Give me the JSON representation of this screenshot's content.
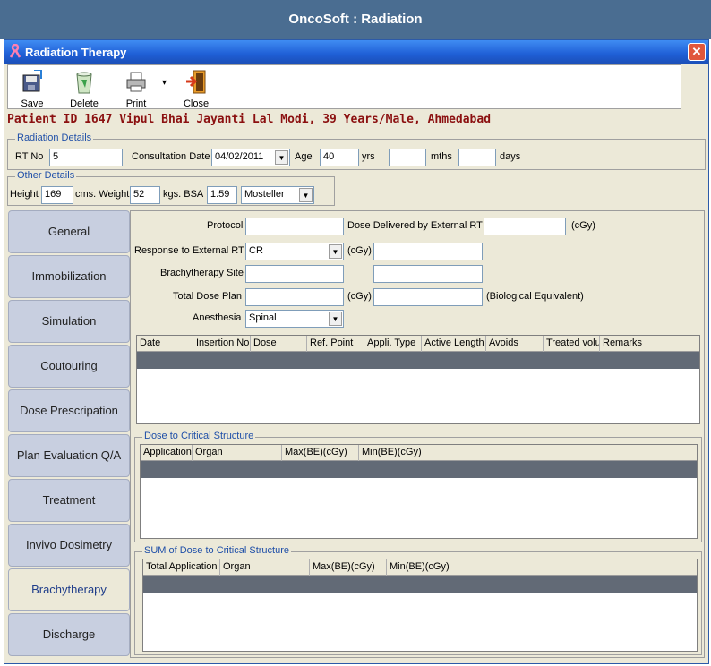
{
  "app": {
    "banner_title": "OncoSoft : Radiation"
  },
  "window": {
    "title": "Radiation Therapy",
    "close_glyph": "✕"
  },
  "toolbar": {
    "save": "Save",
    "delete": "Delete",
    "print": "Print",
    "print_menu_glyph": "▾",
    "close": "Close"
  },
  "patient": {
    "banner": "Patient ID 1647 Vipul Bhai Jayanti Lal  Modi, 39 Years/Male, Ahmedabad"
  },
  "radiation_details": {
    "legend": "Radiation Details",
    "rt_no_label": "RT No",
    "rt_no_value": "5",
    "consult_label": "Consultation Date",
    "consult_value": "04/02/2011",
    "age_label": "Age",
    "age_years_value": "40",
    "yrs": "yrs",
    "age_months_value": "",
    "mths": "mths",
    "age_days_value": "",
    "days": "days"
  },
  "other_details": {
    "legend": "Other Details",
    "height_label": "Height",
    "height_value": "169",
    "cms_weight": "cms. Weight",
    "weight_value": "52",
    "kgs_bsa": "kgs. BSA",
    "bsa_value": "1.59",
    "method_value": "Mosteller"
  },
  "tabs": [
    {
      "label": "General"
    },
    {
      "label": "Immobilization"
    },
    {
      "label": "Simulation"
    },
    {
      "label": "Coutouring"
    },
    {
      "label": "Dose Prescripation"
    },
    {
      "label": "Plan Evaluation Q/A"
    },
    {
      "label": "Treatment"
    },
    {
      "label": "Invivo Dosimetry"
    },
    {
      "label": "Brachytherapy"
    },
    {
      "label": "Discharge"
    }
  ],
  "brachy": {
    "protocol_label": "Protocol",
    "protocol_value": "",
    "dose_ext_label": "Dose Delivered by External RT",
    "dose_ext_value": "",
    "cgy": "(cGy)",
    "response_label": "Response to External RT",
    "response_value": "CR",
    "response_extra_value": "",
    "site_label": "Brachytherapy Site",
    "site_value": "",
    "site_extra_value": "",
    "total_dose_label": "Total Dose Plan",
    "total_dose_value": "",
    "bio_value": "",
    "bio_label": "(Biological Equivalent)",
    "anesthesia_label": "Anesthesia",
    "anesthesia_value": "Spinal"
  },
  "insertion_grid": {
    "columns": [
      "Date",
      "Insertion No",
      "Dose",
      "Ref. Point",
      "Appli. Type",
      "Active Length",
      "Avoids",
      "Treated volu",
      "Remarks"
    ]
  },
  "critical": {
    "legend": "Dose to Critical Structure",
    "columns": [
      "Application",
      "Organ",
      "Max(BE)(cGy)",
      "Min(BE)(cGy)"
    ]
  },
  "sum_critical": {
    "legend": "SUM of Dose to Critical Structure",
    "columns": [
      "Total Application",
      "Organ",
      "Max(BE)(cGy)",
      "Min(BE)(cGy)"
    ]
  },
  "colors": {
    "banner": "#4a6d91",
    "titlebar": "#1f5fd6",
    "patient_text": "#8b1010",
    "legend_text": "#1f4fa8",
    "grid_selected_row": "#626a76"
  }
}
